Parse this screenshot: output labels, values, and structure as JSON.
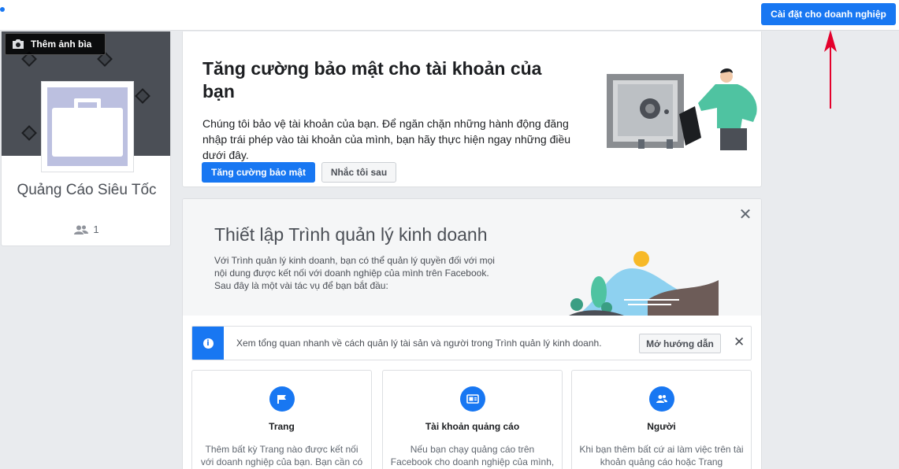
{
  "topbar": {
    "business_settings_label": "Cài đặt cho doanh nghiệp",
    "accent_color": "#1877f2",
    "arrow_color": "#e4002b"
  },
  "profile": {
    "add_cover_label": "Thêm ảnh bìa",
    "camera_icon": "camera-icon",
    "page_name": "Quảng Cáo Siêu Tốc",
    "member_count": "1",
    "people_icon": "people-icon"
  },
  "security": {
    "title": "Tăng cường bảo mật cho tài khoản của bạn",
    "description": "Chúng tôi bảo vệ tài khoản của bạn. Để ngăn chặn những hành động đăng nhập trái phép vào tài khoản của mình, bạn hãy thực hiện ngay những điều dưới đây.",
    "primary_button": "Tăng cường bảo mật",
    "secondary_button": "Nhắc tôi sau"
  },
  "setup": {
    "title": "Thiết lập Trình quản lý kinh doanh",
    "description": "Với Trình quản lý kinh doanh, bạn có thể quản lý quyền đối với mọi nội dung được kết nối với doanh nghiệp của mình trên Facebook. Sau đây là một vài tác vụ để bạn bắt đầu:",
    "close_glyph": "✕",
    "info_bar": {
      "text": "Xem tổng quan nhanh về cách quản lý tài sản và người trong Trình quản lý kinh doanh.",
      "guide_button": "Mở hướng dẫn",
      "info_glyph": "i",
      "close_glyph": "✕"
    },
    "tiles": [
      {
        "icon": "flag-icon",
        "title": "Trang",
        "description": "Thêm bất kỳ Trang nào được kết nối với doanh nghiệp của bạn. Bạn cần có"
      },
      {
        "icon": "ad-account-icon",
        "title": "Tài khoản quảng cáo",
        "description": "Nếu bạn chạy quảng cáo trên Facebook cho doanh nghiệp của mình,"
      },
      {
        "icon": "people-icon",
        "title": "Người",
        "description": "Khi bạn thêm bất cứ ai làm việc trên tài khoản quảng cáo hoặc Trang"
      }
    ]
  }
}
